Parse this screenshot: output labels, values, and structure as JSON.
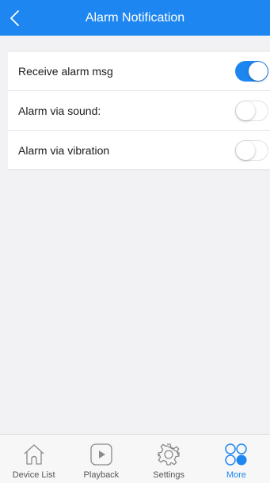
{
  "header": {
    "title": "Alarm Notification"
  },
  "settings": [
    {
      "label": "Receive alarm msg",
      "enabled": true
    },
    {
      "label": "Alarm via sound:",
      "enabled": false
    },
    {
      "label": "Alarm via vibration",
      "enabled": false
    }
  ],
  "tabbar": {
    "tabs": [
      {
        "label": "Device List",
        "icon": "home-icon",
        "active": false
      },
      {
        "label": "Playback",
        "icon": "play-icon",
        "active": false
      },
      {
        "label": "Settings",
        "icon": "gear-icon",
        "active": false
      },
      {
        "label": "More",
        "icon": "more-icon",
        "active": true
      }
    ]
  },
  "colors": {
    "accent": "#1d86f0",
    "background": "#f2f2f4",
    "tab_inactive": "#555555"
  }
}
